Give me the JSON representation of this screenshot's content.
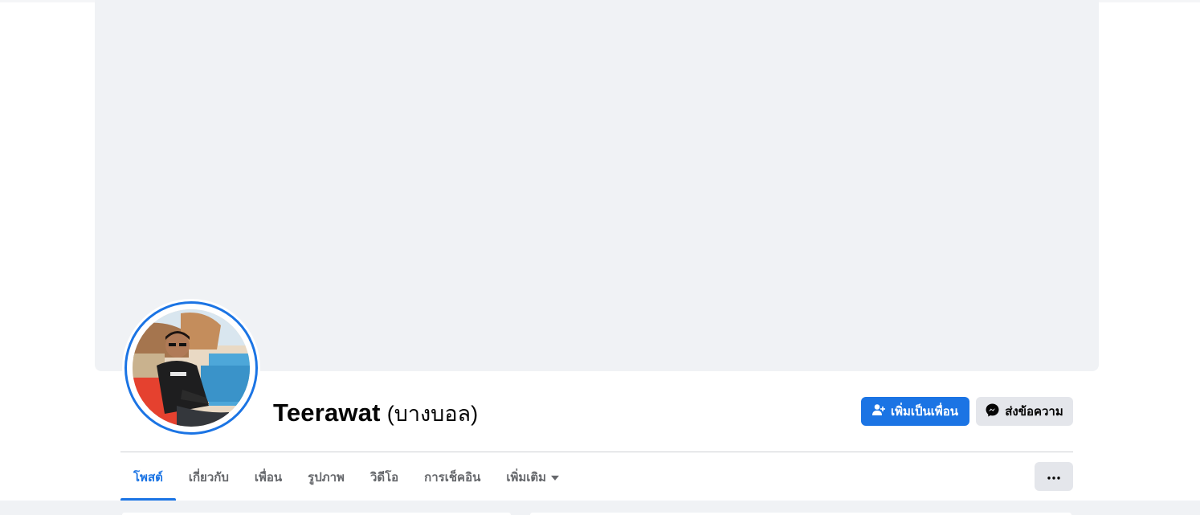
{
  "profile": {
    "name": "Teerawat",
    "alternate_name": "(บางบอล)"
  },
  "actions": {
    "add_friend_label": "เพิ่มเป็นเพื่อน",
    "message_label": "ส่งข้อความ",
    "add_friend_icon": "person-add-icon",
    "message_icon": "messenger-icon",
    "more_icon": "ellipsis-icon"
  },
  "tabs": [
    {
      "label": "โพสต์",
      "active": true
    },
    {
      "label": "เกี่ยวกับ",
      "active": false
    },
    {
      "label": "เพื่อน",
      "active": false
    },
    {
      "label": "รูปภาพ",
      "active": false
    },
    {
      "label": "วิดีโอ",
      "active": false
    },
    {
      "label": "การเช็คอิน",
      "active": false
    },
    {
      "label": "เพิ่มเติม",
      "active": false,
      "icon": "caret-down-icon"
    }
  ],
  "colors": {
    "accent": "#1b74e4",
    "cover_placeholder": "#f0f2f5",
    "secondary_button": "#e4e6eb"
  }
}
